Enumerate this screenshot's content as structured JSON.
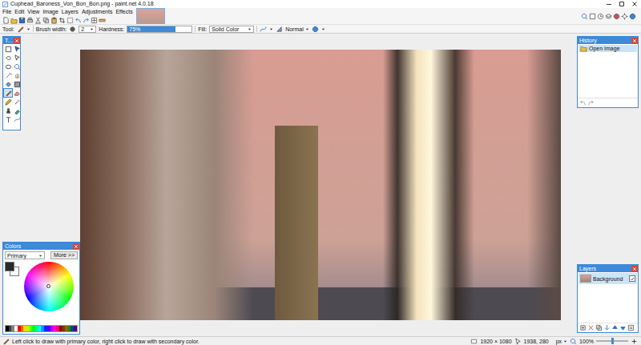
{
  "window": {
    "title": "Cuphead_Baroness_Von_Bon_Bon.png - paint.net 4.0.18"
  },
  "menu": [
    "File",
    "Edit",
    "View",
    "Image",
    "Layers",
    "Adjustments",
    "Effects"
  ],
  "toolbar": {
    "tool_label": "Tool:",
    "brush_width_label": "Brush width:",
    "brush_width": "2",
    "hardness_label": "Hardness:",
    "hardness": "75%",
    "hardness_level": 0.75,
    "fill_label": "Fill:",
    "fill": "Solid Color",
    "blend_mode": "Normal"
  },
  "tools_window": {
    "title": "T...",
    "tools": [
      {
        "selected": false
      },
      {
        "selected": false
      },
      {
        "selected": false
      },
      {
        "selected": false
      },
      {
        "selected": false
      },
      {
        "selected": false
      },
      {
        "selected": false
      },
      {
        "selected": false
      },
      {
        "selected": false
      },
      {
        "selected": false
      },
      {
        "selected": true
      },
      {
        "selected": false
      },
      {
        "selected": false
      },
      {
        "selected": false
      },
      {
        "selected": false
      },
      {
        "selected": false
      },
      {
        "selected": false
      },
      {
        "selected": false
      }
    ]
  },
  "colors_window": {
    "title": "Colors",
    "mode": "Primary",
    "more_button": "More >>",
    "primary": "#2b2b2b",
    "secondary": "#ffffff",
    "palette": [
      "#000000",
      "#404040",
      "#808080",
      "#ffffff",
      "#ff0000",
      "#ff6a00",
      "#ffd800",
      "#b6ff00",
      "#4cff00",
      "#00ff21",
      "#00ff90",
      "#00ffff",
      "#0094ff",
      "#0026ff",
      "#4800ff",
      "#b200ff",
      "#ff00dc",
      "#ff006e",
      "#7f0000",
      "#7f3300",
      "#7f6a00",
      "#267f00",
      "#00497f",
      "#57007f"
    ]
  },
  "history_window": {
    "title": "History",
    "items": [
      {
        "label": "Open Image",
        "selected": true
      }
    ]
  },
  "layers_window": {
    "title": "Layers",
    "layers": [
      {
        "name": "Background",
        "visible": true,
        "selected": true
      }
    ]
  },
  "status_bar": {
    "hint": "Left click to draw with primary color, right click to draw with secondary color.",
    "image_size": "1920 × 1080",
    "cursor": "1938, 280",
    "units": "px",
    "zoom": "100%",
    "zoom_level": 0.5
  }
}
